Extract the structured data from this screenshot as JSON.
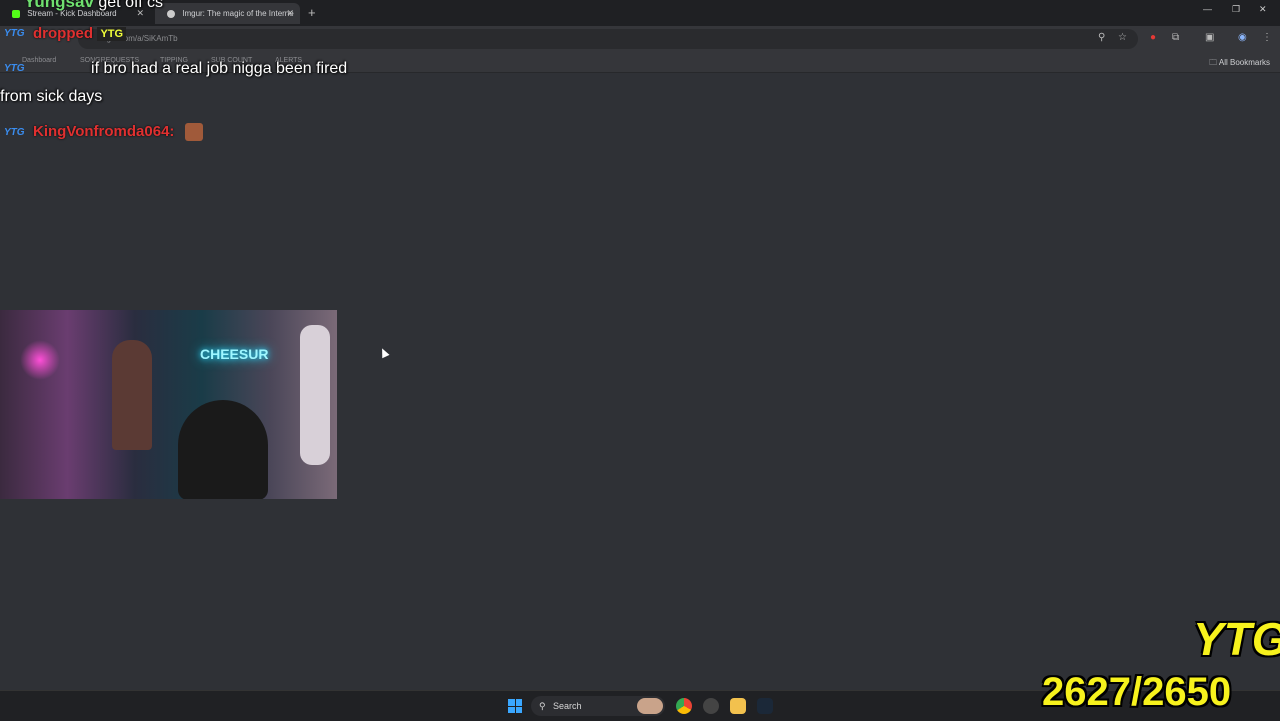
{
  "browser": {
    "tabs": [
      {
        "label": "Stream - Kick Dashboard",
        "favicon_color": "#53fc18"
      },
      {
        "label": "Imgur: The magic of the Interne",
        "favicon_color": "#cccccc"
      }
    ],
    "new_tab_symbol": "+",
    "address": "imgur.com/a/SiKAmTb",
    "bookmarks": [
      "Dashboard",
      "SONGREQUESTS",
      "TIPPING",
      "SUB COUNT",
      "ALERTS"
    ],
    "all_bookmarks_label": "All Bookmarks"
  },
  "chat": {
    "badge": "YTG",
    "top_user": "Yungsav",
    "top_message": "get off cs",
    "line1_user": "dropped",
    "line2_user": "",
    "line2_message": "if bro had a real job nigga been fired",
    "line2_message_cont": "from sick days",
    "line3_user": "KingVonfromda064:"
  },
  "webcam": {
    "neon_sign": "CHEESUR"
  },
  "taskbar": {
    "search_label": "Search"
  },
  "overlay": {
    "logo": "YTG",
    "counter": "2627/2650"
  }
}
